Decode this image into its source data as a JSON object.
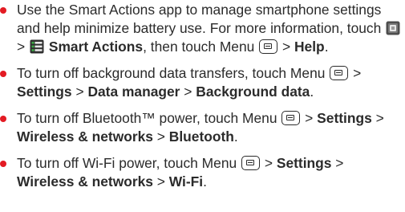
{
  "accent_color": "#e31b23",
  "tips": [
    {
      "bullet_color": "#e31b23",
      "segments": [
        {
          "text": "Use the Smart Actions app to manage smartphone settings and help minimize battery use. For more information, touch "
        },
        {
          "icon": "app-launcher-icon"
        },
        {
          "text": " > "
        },
        {
          "icon": "smart-actions-icon"
        },
        {
          "text": " "
        },
        {
          "text": "Smart Actions",
          "bold": true
        },
        {
          "text": ", then touch Menu "
        },
        {
          "icon": "menu-key-icon"
        },
        {
          "text": " > "
        },
        {
          "text": "Help",
          "bold": true
        },
        {
          "text": "."
        }
      ]
    },
    {
      "bullet_color": "#e31b23",
      "segments": [
        {
          "text": "To turn off background data transfers, touch Menu "
        },
        {
          "icon": "menu-key-icon"
        },
        {
          "text": " > "
        },
        {
          "text": "Settings",
          "bold": true
        },
        {
          "text": " > "
        },
        {
          "text": "Data manager",
          "bold": true
        },
        {
          "text": " > "
        },
        {
          "text": "Background data",
          "bold": true
        },
        {
          "text": "."
        }
      ]
    },
    {
      "bullet_color": "#e31b23",
      "segments": [
        {
          "text": "To turn off Bluetooth™ power, touch Menu "
        },
        {
          "icon": "menu-key-icon"
        },
        {
          "text": " > "
        },
        {
          "text": "Settings",
          "bold": true
        },
        {
          "text": " > "
        },
        {
          "text": "Wireless & networks",
          "bold": true
        },
        {
          "text": " > "
        },
        {
          "text": "Bluetooth",
          "bold": true
        },
        {
          "text": "."
        }
      ]
    },
    {
      "bullet_color": "#e31b23",
      "segments": [
        {
          "text": "To turn off Wi-Fi power, touch Menu "
        },
        {
          "icon": "menu-key-icon"
        },
        {
          "text": " > "
        },
        {
          "text": "Settings",
          "bold": true
        },
        {
          "text": " > "
        },
        {
          "text": "Wireless & networks",
          "bold": true
        },
        {
          "text": " > "
        },
        {
          "text": "Wi-Fi",
          "bold": true
        },
        {
          "text": "."
        }
      ]
    }
  ]
}
